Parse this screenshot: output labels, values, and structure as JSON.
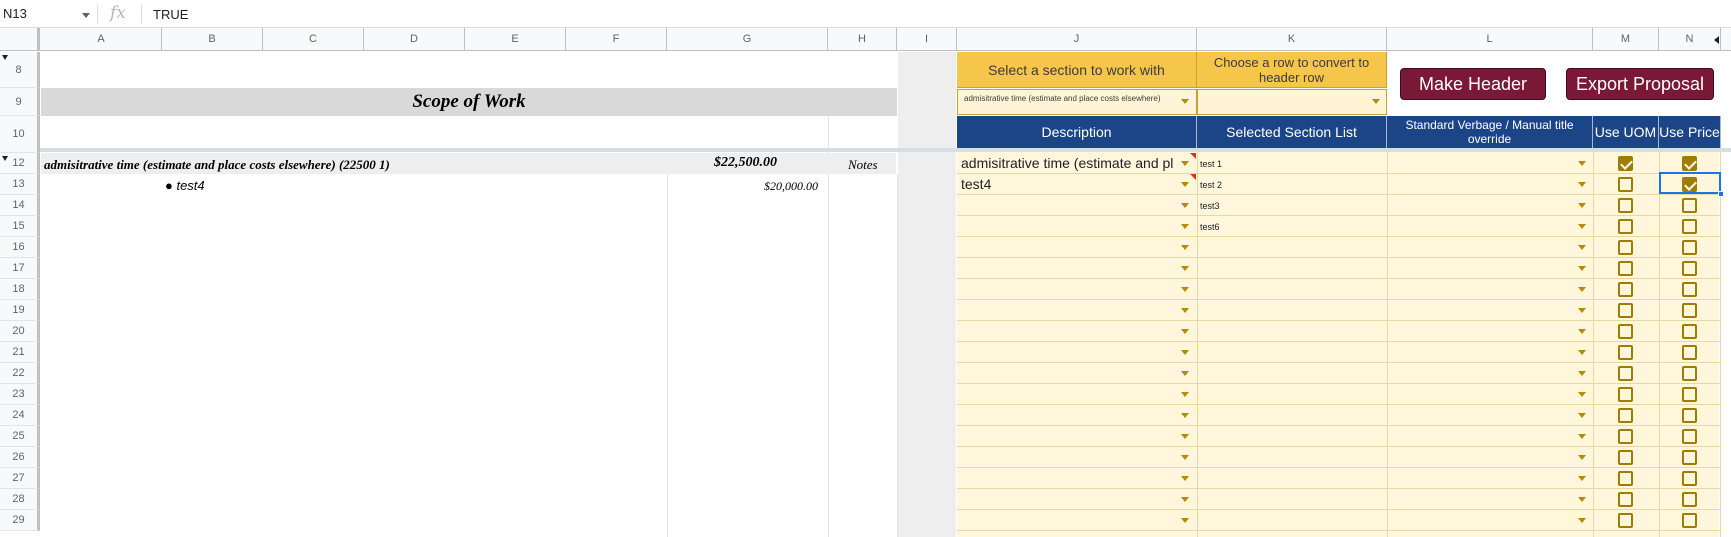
{
  "formula_bar": {
    "cell_ref": "N13",
    "fx_symbol": "fx",
    "value": "TRUE"
  },
  "columns": [
    "A",
    "B",
    "C",
    "D",
    "E",
    "F",
    "G",
    "H",
    "I",
    "J",
    "K",
    "L",
    "M",
    "N"
  ],
  "rows": [
    "8",
    "9",
    "10",
    "12",
    "13",
    "14",
    "15",
    "16",
    "17",
    "18",
    "19",
    "20",
    "21",
    "22",
    "23",
    "24",
    "25",
    "26",
    "27",
    "28",
    "29"
  ],
  "sheet": {
    "scope_title": "Scope of Work",
    "section_label": "admisitrative time (estimate and place costs elsewhere) (22500 1)",
    "section_amount": "$22,500.00",
    "section_notes": "Notes",
    "item_label": "● test4",
    "item_amount": "$20,000.00"
  },
  "panel": {
    "select_section_label": "Select a section to work with",
    "select_section_value": "admisitrative time (estimate and place costs elsewhere)",
    "choose_row_label": "Choose a row to convert to header row",
    "choose_row_value": "",
    "make_header_button": "Make Header",
    "export_button": "Export Proposal",
    "headers": {
      "description": "Description",
      "selected_section_list": "Selected Section List",
      "standard_verbage": "Standard Verbage / Manual title override",
      "use_uom": "Use UOM",
      "use_price": "Use Price"
    },
    "rows": [
      {
        "description": "admisitrative time (estimate and pl",
        "section_item": "test 1",
        "use_uom": true,
        "use_price": true
      },
      {
        "description": "test4",
        "section_item": "test 2",
        "use_uom": false,
        "use_price": true
      },
      {
        "description": "",
        "section_item": "test3",
        "use_uom": false,
        "use_price": false
      },
      {
        "description": "",
        "section_item": "test6",
        "use_uom": false,
        "use_price": false
      },
      {
        "description": "",
        "section_item": "",
        "use_uom": false,
        "use_price": false
      },
      {
        "description": "",
        "section_item": "",
        "use_uom": false,
        "use_price": false
      },
      {
        "description": "",
        "section_item": "",
        "use_uom": false,
        "use_price": false
      },
      {
        "description": "",
        "section_item": "",
        "use_uom": false,
        "use_price": false
      },
      {
        "description": "",
        "section_item": "",
        "use_uom": false,
        "use_price": false
      },
      {
        "description": "",
        "section_item": "",
        "use_uom": false,
        "use_price": false
      },
      {
        "description": "",
        "section_item": "",
        "use_uom": false,
        "use_price": false
      },
      {
        "description": "",
        "section_item": "",
        "use_uom": false,
        "use_price": false
      },
      {
        "description": "",
        "section_item": "",
        "use_uom": false,
        "use_price": false
      },
      {
        "description": "",
        "section_item": "",
        "use_uom": false,
        "use_price": false
      },
      {
        "description": "",
        "section_item": "",
        "use_uom": false,
        "use_price": false
      },
      {
        "description": "",
        "section_item": "",
        "use_uom": false,
        "use_price": false
      },
      {
        "description": "",
        "section_item": "",
        "use_uom": false,
        "use_price": false
      },
      {
        "description": "",
        "section_item": "",
        "use_uom": false,
        "use_price": false
      }
    ]
  }
}
